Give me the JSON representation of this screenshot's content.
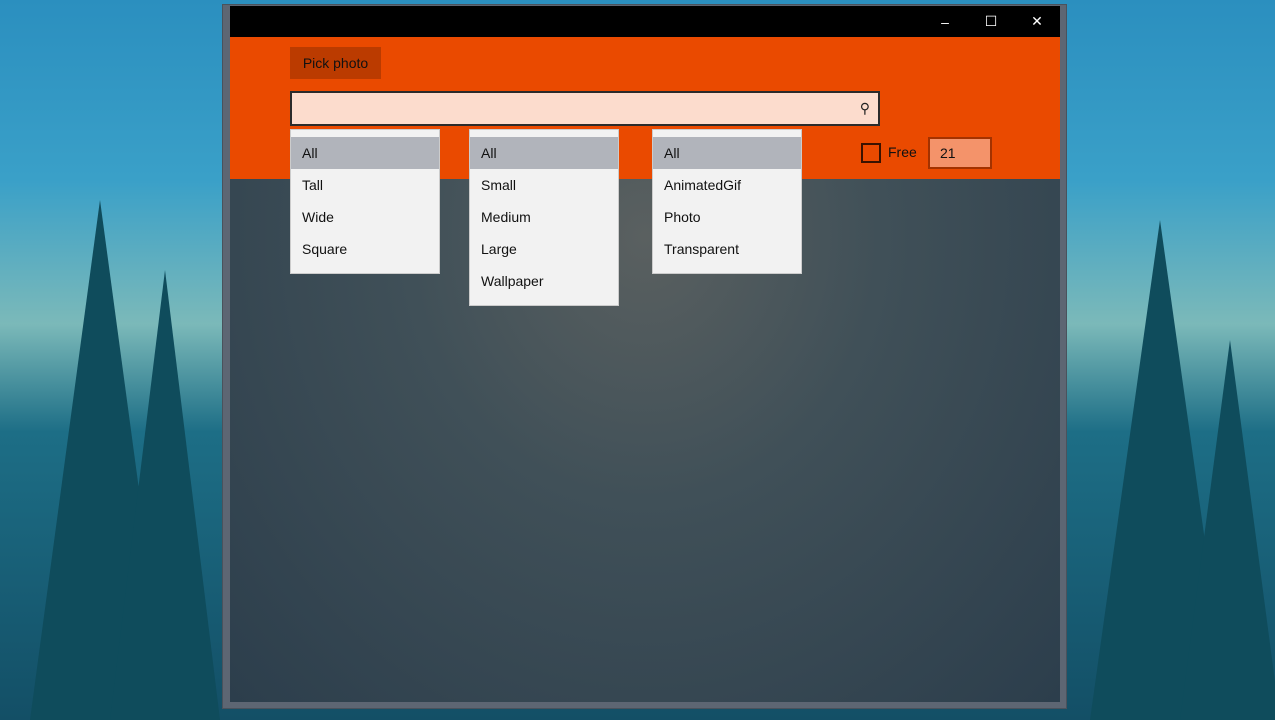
{
  "window": {
    "minimize_icon": "minimize-icon",
    "maximize_icon": "maximize-icon",
    "close_icon": "close-icon"
  },
  "toolbar": {
    "pick_photo_label": "Pick photo"
  },
  "search": {
    "value": "",
    "icon": "search-icon"
  },
  "filters": {
    "aspect": {
      "selected": "All",
      "options": [
        "All",
        "Tall",
        "Wide",
        "Square"
      ]
    },
    "size": {
      "selected": "All",
      "options": [
        "All",
        "Small",
        "Medium",
        "Large",
        "Wallpaper"
      ]
    },
    "type": {
      "selected": "All",
      "options": [
        "All",
        "AnimatedGif",
        "Photo",
        "Transparent"
      ]
    }
  },
  "free": {
    "label": "Free",
    "checked": false
  },
  "count": {
    "value": "21"
  },
  "colors": {
    "accent": "#ea4a00",
    "selected": "#b1b4bb"
  }
}
